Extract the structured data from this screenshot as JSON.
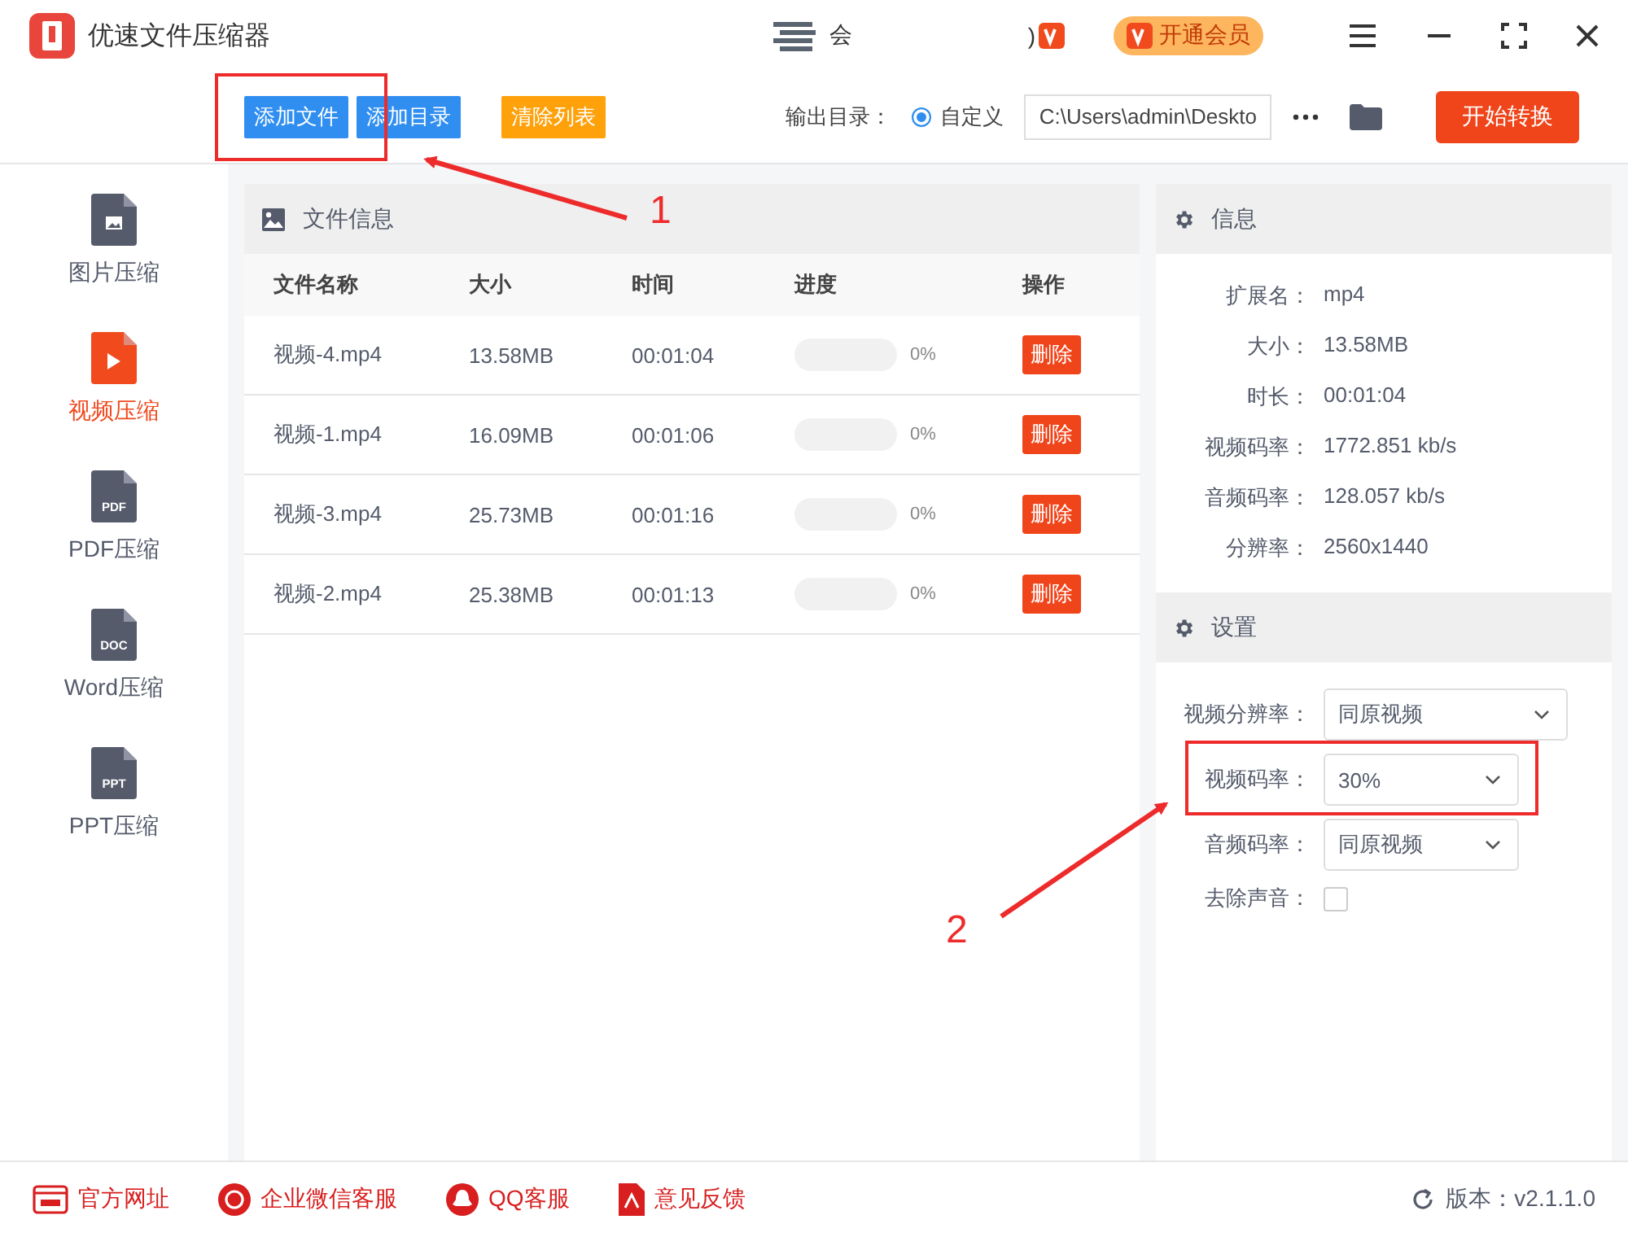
{
  "title_bar": {
    "title": "优速文件压缩器",
    "texts": [
      "会",
      ")"
    ],
    "vip_button": "开通会员"
  },
  "toolbar": {
    "buttons": [
      {
        "label": "添加文件",
        "kind": "blue"
      },
      {
        "label": "添加目录",
        "kind": "blue"
      },
      {
        "label": "清除列表",
        "kind": "orange"
      }
    ],
    "output_label": "输出目录：",
    "radio": {
      "label": "自定义",
      "selected": true
    },
    "path": "C:\\Users\\admin\\Deskto",
    "start_button": "开始转换"
  },
  "sidebar": {
    "items": [
      {
        "label": "图片压缩",
        "kind": "image",
        "selected": false
      },
      {
        "label": "视频压缩",
        "kind": "video",
        "selected": true
      },
      {
        "label": "PDF压缩",
        "kind": "doc",
        "badge": "PDF",
        "selected": false
      },
      {
        "label": "Word压缩",
        "kind": "doc",
        "badge": "DOC",
        "selected": false
      },
      {
        "label": "PPT压缩",
        "kind": "doc",
        "badge": "PPT",
        "selected": false
      }
    ]
  },
  "file_panel": {
    "title": "文件信息",
    "columns": [
      "文件名称",
      "大小",
      "时间",
      "进度",
      "操作"
    ],
    "rows": [
      {
        "name": "视频-4.mp4",
        "size": "13.58MB",
        "time": "00:01:04",
        "level": 0,
        "progress": "0%",
        "action": "删除"
      },
      {
        "name": "视频-1.mp4",
        "size": "16.09MB",
        "time": "00:01:06",
        "level": 0,
        "progress": "0%",
        "action": "删除"
      },
      {
        "name": "视频-3.mp4",
        "size": "25.73MB",
        "time": "00:01:16",
        "level": 0,
        "progress": "0%",
        "action": "删除"
      },
      {
        "name": "视频-2.mp4",
        "size": "25.38MB",
        "time": "00:01:13",
        "level": 0,
        "progress": "0%",
        "action": "删除"
      }
    ]
  },
  "info_panel": {
    "title": "信息",
    "fields": [
      {
        "label": "扩展名：",
        "value": "mp4"
      },
      {
        "label": "大小：",
        "value": "13.58MB"
      },
      {
        "label": "时长：",
        "value": "00:01:04"
      },
      {
        "label": "视频码率：",
        "value": "1772.851 kb/s"
      },
      {
        "label": "音频码率：",
        "value": "128.057 kb/s"
      },
      {
        "label": "分辨率：",
        "value": "2560x1440"
      }
    ]
  },
  "settings_panel": {
    "title": "设置",
    "fields": [
      {
        "kind": "select",
        "label": "视频分辨率：",
        "value": "同原视频",
        "wide": true
      },
      {
        "kind": "select",
        "label": "视频码率：",
        "value": "30%",
        "wide": false
      },
      {
        "kind": "select",
        "label": "音频码率：",
        "value": "同原视频",
        "wide": false
      },
      {
        "kind": "checkbox",
        "label": "去除声音：",
        "checked": false
      }
    ]
  },
  "footer": {
    "links": [
      {
        "label": "官方网址",
        "kind": "web"
      },
      {
        "label": "企业微信客服",
        "kind": "chat"
      },
      {
        "label": "QQ客服",
        "kind": "qq"
      },
      {
        "label": "意见反馈",
        "kind": "feedback"
      }
    ],
    "version": "版本：v2.1.1.0"
  },
  "annotations": [
    {
      "label": "1"
    },
    {
      "label": "2"
    }
  ]
}
